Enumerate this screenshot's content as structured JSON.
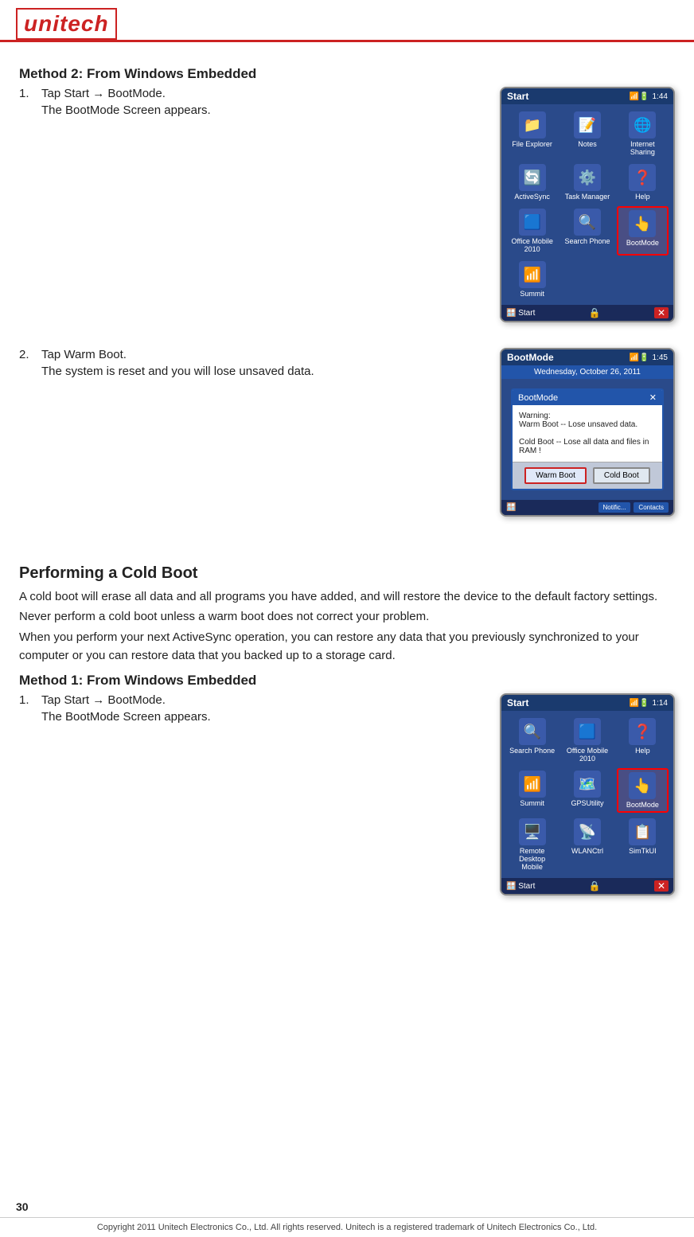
{
  "header": {
    "logo_text": "unitech"
  },
  "section1": {
    "title": "Method 2: From Windows Embedded",
    "step1_num": "1.",
    "step1_text": "Tap Start  →  BootMode.",
    "step1_sub": "The BootMode Screen appears.",
    "step2_num": "2.",
    "step2_text": "Tap Warm Boot.",
    "step2_sub": "The system is reset and you will lose unsaved data.",
    "screenshot1": {
      "titlebar_title": "Start",
      "titlebar_time": "1:44",
      "icons": [
        {
          "label": "File Explorer",
          "icon": "📁"
        },
        {
          "label": "Notes",
          "icon": "📝"
        },
        {
          "label": "Internet Sharing",
          "icon": "🌐"
        },
        {
          "label": "ActiveSync",
          "icon": "🔄"
        },
        {
          "label": "Task Manager",
          "icon": "⚙️"
        },
        {
          "label": "Help",
          "icon": "❓"
        },
        {
          "label": "Office Mobile 2010",
          "icon": "🟦"
        },
        {
          "label": "Search Phone",
          "icon": "🔍"
        },
        {
          "label": "BootMode",
          "icon": "👆",
          "highlighted": true
        },
        {
          "label": "Summit",
          "icon": "📶"
        }
      ]
    },
    "screenshot2": {
      "titlebar_title": "BootMode",
      "titlebar_time": "1:45",
      "date_bar": "Wednesday, October 26, 2011",
      "dialog_title": "BootMode",
      "warning_text": "Warning:\nWarm Boot -- Lose unsaved data.\n\nCold Boot -- Lose all data and files in RAM !",
      "btn_warm": "Warm Boot",
      "btn_cold": "Cold Boot",
      "taskbar_left": "🪟",
      "taskbar_btn1": "Notific...",
      "taskbar_btn2": "Contacts"
    }
  },
  "section2": {
    "title": "Performing a Cold Boot",
    "para1": "A cold boot will erase all data and all programs you have added, and will restore the device to the default factory settings.",
    "para2": "Never perform a cold boot unless a warm boot does not correct your problem.",
    "para3": "When you perform your next ActiveSync operation, you can restore any data that you previously synchronized to your computer or you can restore data that you backed up to a storage card.",
    "method1_title": "Method 1: From Windows Embedded",
    "step1_num": "1.",
    "step1_text": "Tap Start  →  BootMode.",
    "step1_sub": "The BootMode Screen appears.",
    "screenshot3": {
      "titlebar_title": "Start",
      "titlebar_time": "1:14",
      "icons": [
        {
          "label": "Search Phone",
          "icon": "🔍"
        },
        {
          "label": "Office Mobile 2010",
          "icon": "🟦"
        },
        {
          "label": "Help",
          "icon": "❓"
        },
        {
          "label": "Summit",
          "icon": "📶"
        },
        {
          "label": "GPSUtility",
          "icon": "🗺️"
        },
        {
          "label": "BootMode",
          "icon": "👆",
          "highlighted": true
        },
        {
          "label": "Remote Desktop Mobile",
          "icon": "🖥️"
        },
        {
          "label": "WLANCtrl",
          "icon": "📡"
        },
        {
          "label": "SimTkUI",
          "icon": "📋"
        }
      ]
    }
  },
  "footer": {
    "page_num": "30",
    "copyright": "Copyright 2011 Unitech Electronics Co., Ltd. All rights reserved. Unitech is a registered trademark of Unitech Electronics Co., Ltd."
  }
}
